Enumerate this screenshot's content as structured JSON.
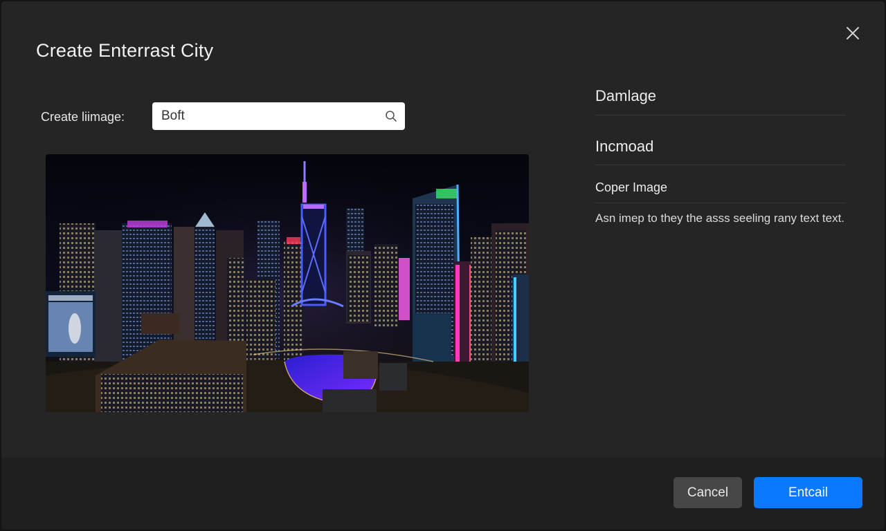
{
  "dialog": {
    "title": "Create Enterrast City",
    "close_icon": "close-icon"
  },
  "form": {
    "label": "Create liimage:",
    "search_value": "Boft",
    "search_icon": "search-icon"
  },
  "sidebar": {
    "item1": "Damlage",
    "item2": "Incmoad",
    "item3": "Coper Image",
    "description": "Asn imep to they the asss seeling rany text text."
  },
  "footer": {
    "cancel_label": "Cancel",
    "primary_label": "Entcail",
    "primary_color": "#0a78ff"
  }
}
